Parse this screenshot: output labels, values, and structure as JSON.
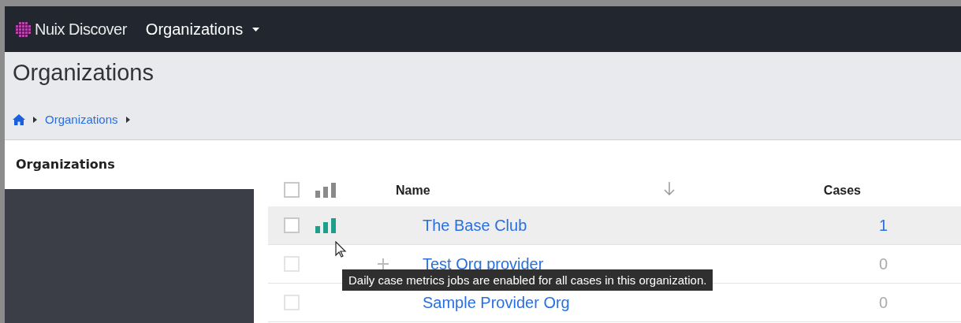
{
  "top_bar": {
    "brand": "Nuix Discover",
    "menu": {
      "label": "Organizations",
      "has_dropdown": true
    }
  },
  "page_title": "Organizations",
  "breadcrumb": [
    {
      "label": "Organizations"
    }
  ],
  "sidebar": {
    "title": "Organizations"
  },
  "table": {
    "columns": [
      {
        "label": "Name",
        "sort_descending": true
      },
      {
        "label": "Cases"
      }
    ],
    "header_checkbox": {
      "checked": false
    },
    "rows": [
      {
        "name": "The Base Club",
        "cases": "1",
        "selected": false,
        "highlighted": true,
        "metrics_enabled": true,
        "expandable": false,
        "disabled": false
      },
      {
        "name": "Test Org provider",
        "cases": "0",
        "selected": false,
        "highlighted": false,
        "metrics_enabled": false,
        "expandable": true,
        "disabled": true
      },
      {
        "name": "Sample Provider Org",
        "cases": "0",
        "selected": false,
        "highlighted": false,
        "metrics_enabled": false,
        "expandable": false,
        "disabled": true
      }
    ]
  },
  "tooltip": {
    "text": "Daily case metrics jobs are enabled for all cases in this organization."
  }
}
